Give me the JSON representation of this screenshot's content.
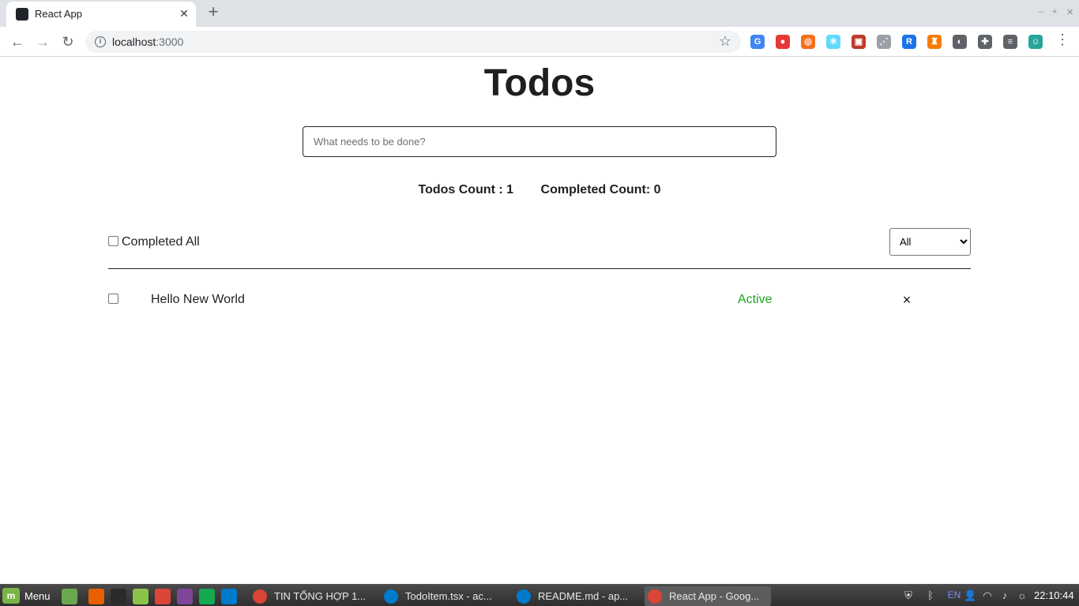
{
  "browser": {
    "tab_title": "React App",
    "tab_close_glyph": "✕",
    "new_tab_glyph": "+",
    "window_controls": [
      "–",
      "+",
      "✕"
    ],
    "url_host": "localhost",
    "url_port": ":3000",
    "nav_back_glyph": "←",
    "nav_forward_glyph": "→",
    "nav_reload_glyph": "↻",
    "star_glyph": "☆",
    "menu_glyph": "⋮",
    "extensions": [
      {
        "icon": "translate-icon",
        "glyph": "G",
        "color": "#4285f4"
      },
      {
        "icon": "adblock-icon",
        "glyph": "●",
        "color": "#e53935"
      },
      {
        "icon": "ublock-icon",
        "glyph": "◎",
        "color": "#f4701d"
      },
      {
        "icon": "react-devtools-icon",
        "glyph": "⚛",
        "color": "#61dafb"
      },
      {
        "icon": "toolbox-icon",
        "glyph": "▣",
        "color": "#c0392b"
      },
      {
        "icon": "loading-icon",
        "glyph": "⋰",
        "color": "#9aa0a6"
      },
      {
        "icon": "r-extension-icon",
        "glyph": "R",
        "color": "#1a73e8"
      },
      {
        "icon": "lock-extension-icon",
        "glyph": "♜",
        "color": "#f57c00"
      },
      {
        "icon": "dark-mode-icon",
        "glyph": "◐",
        "color": "#5f6368"
      },
      {
        "icon": "extensions-icon",
        "glyph": "✚",
        "color": "#5f6368"
      },
      {
        "icon": "media-icon",
        "glyph": "≡",
        "color": "#5f6368"
      },
      {
        "icon": "profile-icon",
        "glyph": "☺",
        "color": "#26a69a"
      }
    ]
  },
  "app": {
    "title": "Todos",
    "input_placeholder": "What needs to be done?",
    "todos_count_text": "Todos Count : 1",
    "completed_count_text": "Completed Count: 0",
    "completed_all_label": "Completed All",
    "filter_selected": "All",
    "todos": [
      {
        "text": "Hello New World",
        "status": "Active",
        "completed": false,
        "delete_glyph": "×"
      }
    ]
  },
  "taskbar": {
    "start_label": "Menu",
    "launchers": [
      {
        "icon": "show-desktop-icon",
        "color": "#6aa84f"
      },
      {
        "icon": "firefox-icon",
        "color": "#e66000"
      },
      {
        "icon": "terminal-icon",
        "color": "#2b2b2b"
      },
      {
        "icon": "files-icon",
        "color": "#8bc34a"
      },
      {
        "icon": "chrome-icon",
        "color": "#db4437"
      },
      {
        "icon": "tor-browser-icon",
        "color": "#7d4698"
      },
      {
        "icon": "mongodb-compass-icon",
        "color": "#13aa52"
      },
      {
        "icon": "vscode-icon",
        "color": "#007acc"
      }
    ],
    "windows": [
      {
        "label": "TIN TỔNG HỢP 1...",
        "icon": "chrome-icon",
        "color": "#db4437",
        "active": false
      },
      {
        "label": "TodoItem.tsx - ac...",
        "icon": "vscode-icon",
        "color": "#007acc",
        "active": false
      },
      {
        "label": "README.md - ap...",
        "icon": "vscode-icon",
        "color": "#007acc",
        "active": false
      },
      {
        "label": "React App - Goog...",
        "icon": "chrome-icon",
        "color": "#db4437",
        "active": true
      }
    ],
    "tray": [
      {
        "icon": "shield-icon",
        "glyph": "⛨"
      },
      {
        "icon": "bluetooth-icon",
        "glyph": "ᛒ"
      },
      {
        "icon": "keyboard-layout-indicator",
        "glyph": "EN"
      },
      {
        "icon": "user-icon",
        "glyph": "👤"
      },
      {
        "icon": "wifi-icon",
        "glyph": "◠"
      },
      {
        "icon": "volume-icon",
        "glyph": "♪"
      },
      {
        "icon": "brightness-icon",
        "glyph": "☼"
      }
    ],
    "clock": "22:10:44"
  }
}
